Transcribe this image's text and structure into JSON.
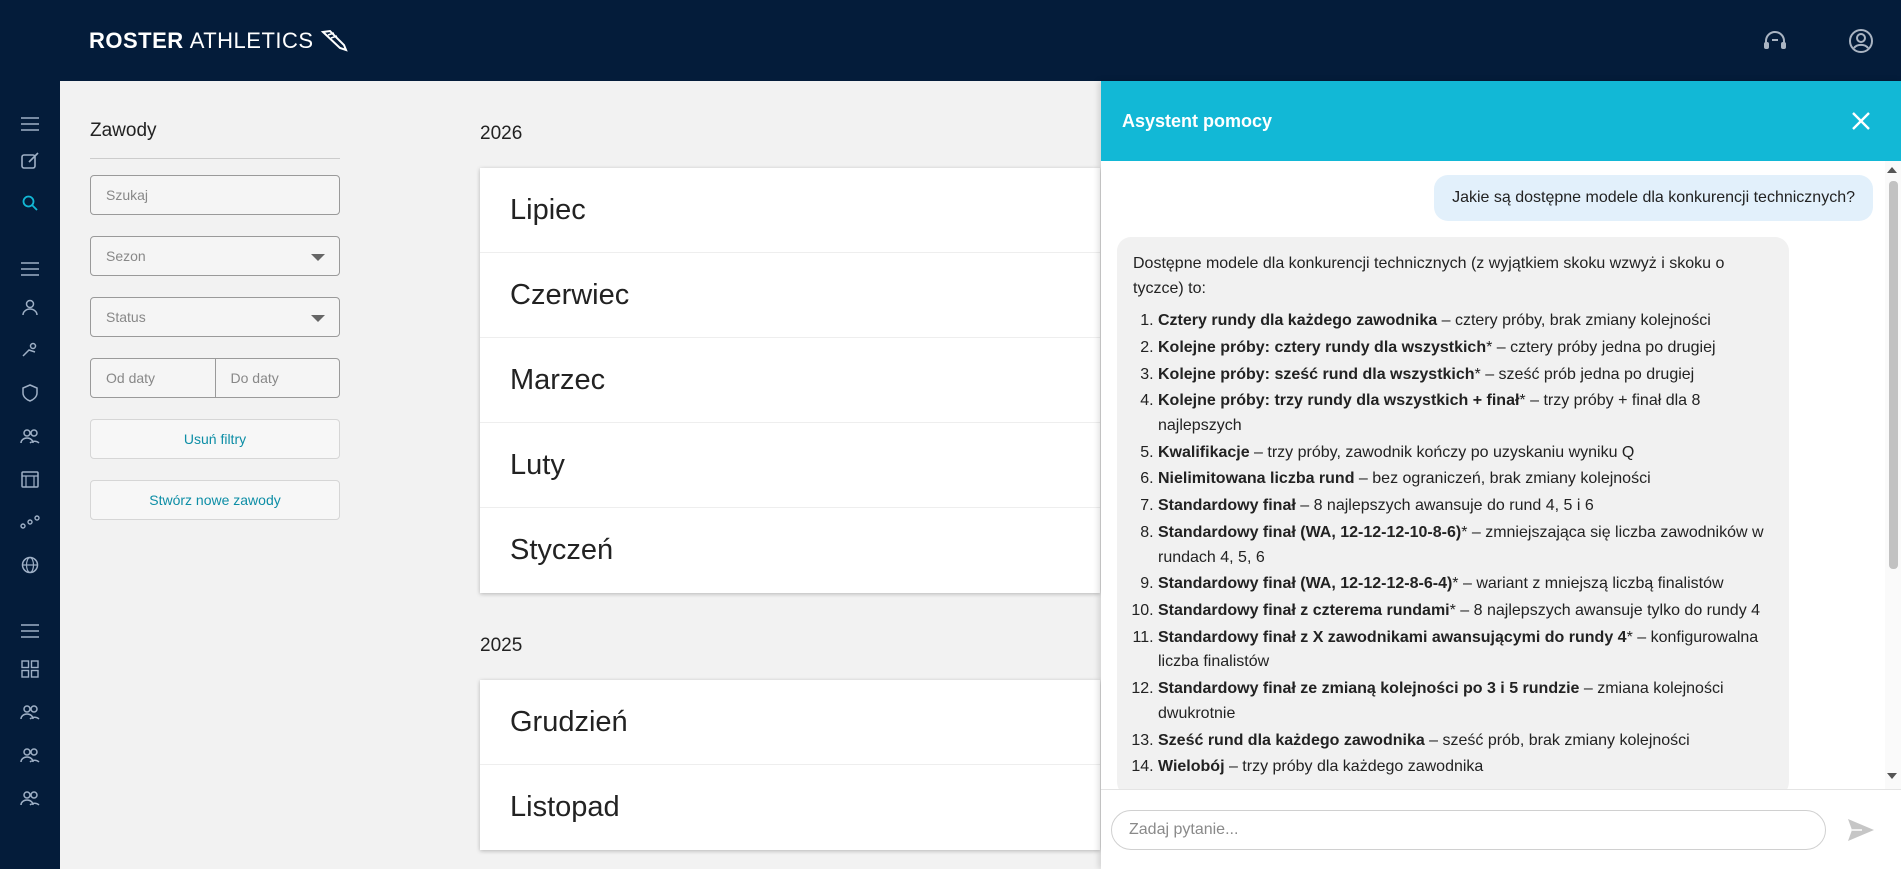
{
  "app": {
    "logo_bold": "ROSTER",
    "logo_light": "ATHLETICS"
  },
  "filters": {
    "title": "Zawody",
    "search_placeholder": "Szukaj",
    "season_placeholder": "Sezon",
    "status_placeholder": "Status",
    "date_from": "Od daty",
    "date_to": "Do daty",
    "clear_label": "Usuń filtry",
    "create_label": "Stwórz nowe zawody"
  },
  "years": [
    {
      "year": "2026",
      "months": [
        "Lipiec",
        "Czerwiec",
        "Marzec",
        "Luty",
        "Styczeń"
      ]
    },
    {
      "year": "2025",
      "months": [
        "Grudzień",
        "Listopad"
      ]
    }
  ],
  "assistant": {
    "title": "Asystent pomocy",
    "user_message": "Jakie są dostępne modele dla konkurencji technicznych?",
    "bot_intro": "Dostępne modele dla konkurencji technicznych (z wyjątkiem skoku wzwyż i skoku o tyczce) to:",
    "items": [
      {
        "bold": "Cztery rundy dla każdego zawodnika",
        "rest": " – cztery próby, brak zmiany kolejności"
      },
      {
        "bold": "Kolejne próby: cztery rundy dla wszystkich",
        "rest": "* – cztery próby jedna po drugiej"
      },
      {
        "bold": "Kolejne próby: sześć rund dla wszystkich",
        "rest": "* – sześć prób jedna po drugiej"
      },
      {
        "bold": "Kolejne próby: trzy rundy dla wszystkich + finał",
        "rest": "* – trzy próby + finał dla 8 najlepszych"
      },
      {
        "bold": "Kwalifikacje",
        "rest": " – trzy próby, zawodnik kończy po uzyskaniu wyniku Q"
      },
      {
        "bold": "Nielimitowana liczba rund",
        "rest": " – bez ograniczeń, brak zmiany kolejności"
      },
      {
        "bold": "Standardowy finał",
        "rest": " – 8 najlepszych awansuje do rund 4, 5 i 6"
      },
      {
        "bold": "Standardowy finał (WA, 12-12-12-10-8-6)",
        "rest": "* – zmniejszająca się liczba zawodników w rundach 4, 5, 6"
      },
      {
        "bold": "Standardowy finał (WA, 12-12-12-8-6-4)",
        "rest": "* – wariant z mniejszą liczbą finalistów"
      },
      {
        "bold": "Standardowy finał z czterema rundami",
        "rest": "* – 8 najlepszych awansuje tylko do rundy 4"
      },
      {
        "bold": "Standardowy finał z X zawodnikami awansującymi do rundy 4",
        "rest": "* – konfigurowalna liczba finalistów"
      },
      {
        "bold": "Standardowy finał ze zmianą kolejności po 3 i 5 rundzie",
        "rest": " – zmiana kolejności dwukrotnie"
      },
      {
        "bold": "Sześć rund dla każdego zawodnika",
        "rest": " – sześć prób, brak zmiany kolejności"
      },
      {
        "bold": "Wielobój",
        "rest": " – trzy próby dla każdego zawodnika"
      }
    ],
    "input_placeholder": "Zadaj pytanie..."
  },
  "colors": {
    "navy": "#041c3a",
    "accent": "#12b8d6",
    "link": "#0d8ea6"
  },
  "icons": {
    "top": [
      "support-headset-icon",
      "account-icon"
    ],
    "sidebar": [
      "menu-icon",
      "edit-icon",
      "search-icon",
      "menu-icon",
      "person-icon",
      "athlete-icon",
      "shield-icon",
      "group-icon",
      "calendar-icon",
      "relay-icon",
      "globe-icon",
      "menu-icon",
      "grid-icon",
      "group-icon",
      "group-icon",
      "group-icon"
    ]
  }
}
